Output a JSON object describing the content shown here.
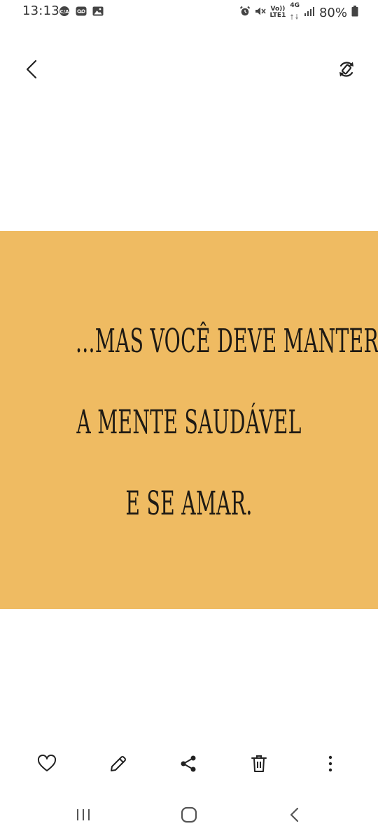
{
  "status_bar": {
    "time": "13:13",
    "network_line1": "Vo))",
    "network_line2": "LTE1",
    "network_type": "4G",
    "battery": "80%"
  },
  "viewer": {
    "image_background": "#efbb62",
    "quote_lines": [
      "...Mas você deve manter",
      "a mente saudável",
      "e se amar."
    ]
  },
  "icons": {
    "back": "chevron-left-icon",
    "rotate": "rotate-icon",
    "favorite": "heart-icon",
    "edit": "pencil-icon",
    "share": "share-icon",
    "delete": "trash-icon",
    "more": "more-vertical-icon",
    "recents": "recents-icon",
    "home": "home-icon",
    "nav_back": "nav-back-icon"
  }
}
